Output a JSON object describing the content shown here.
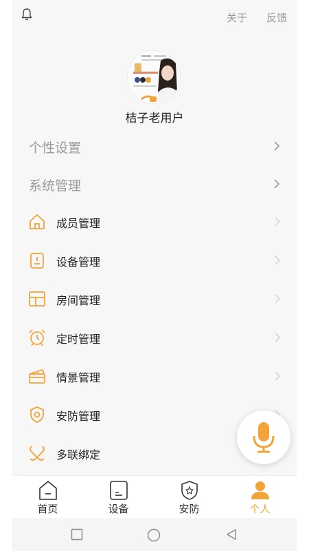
{
  "header": {
    "about": "关于",
    "feedback": "反馈"
  },
  "profile": {
    "username": "桔子老用户"
  },
  "settings": [
    {
      "label": "个性设置"
    },
    {
      "label": "系统管理"
    }
  ],
  "menu": [
    {
      "label": "成员管理",
      "icon": "home-icon"
    },
    {
      "label": "设备管理",
      "icon": "device-icon"
    },
    {
      "label": "房间管理",
      "icon": "room-icon"
    },
    {
      "label": "定时管理",
      "icon": "alarm-clock-icon"
    },
    {
      "label": "情景管理",
      "icon": "scene-icon"
    },
    {
      "label": "安防管理",
      "icon": "shield-icon"
    },
    {
      "label": "多联绑定",
      "icon": "link-icon"
    }
  ],
  "tabs": [
    {
      "label": "首页",
      "icon": "home-tab-icon"
    },
    {
      "label": "设备",
      "icon": "device-tab-icon"
    },
    {
      "label": "安防",
      "icon": "security-tab-icon"
    },
    {
      "label": "个人",
      "icon": "person-tab-icon",
      "active": true
    }
  ],
  "colors": {
    "accent": "#f2a43a",
    "background": "#f8f7f8",
    "muted_text": "#9a9a9a"
  }
}
